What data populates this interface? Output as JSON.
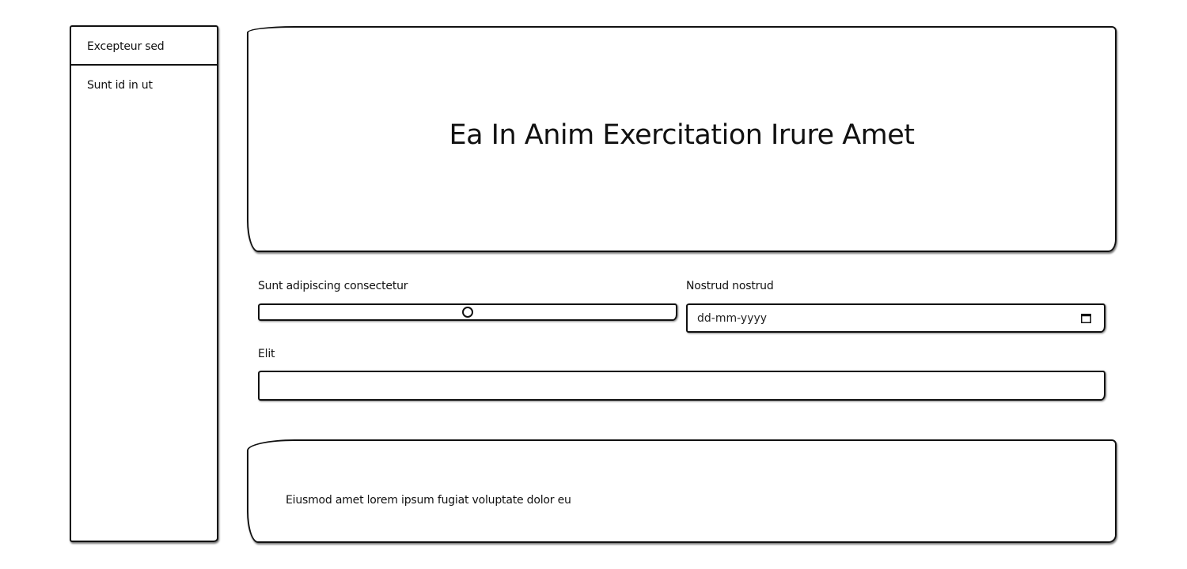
{
  "sidebar": {
    "items": [
      {
        "label": "Excepteur sed"
      },
      {
        "label": "Sunt id in ut"
      }
    ]
  },
  "hero": {
    "title": "Ea In Anim Exercitation Irure Amet"
  },
  "form": {
    "range": {
      "label": "Sunt adipiscing consectetur",
      "value": 50,
      "min": 0,
      "max": 100
    },
    "date": {
      "label": "Nostrud nostrud",
      "placeholder": "dd-mm-yyyy",
      "icon": "calendar-icon"
    },
    "text": {
      "label": "Elit",
      "value": ""
    }
  },
  "footer": {
    "text": "Eiusmod amet lorem ipsum fugiat voluptate dolor eu"
  }
}
